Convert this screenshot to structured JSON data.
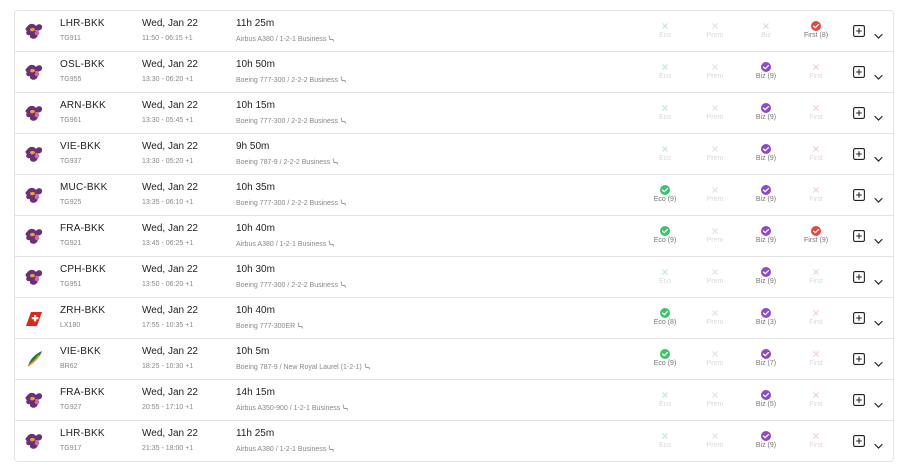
{
  "colors": {
    "eco": "#3cc46b",
    "biz": "#8f49c9",
    "first": "#e5473f",
    "off_x": "#c4ecd2",
    "off_x_prem": "#dde5f0",
    "off_x_biz": "#e2d8ec",
    "off_x_first": "#f5d3d0"
  },
  "flights": [
    {
      "airline_logo": "thai-airways-logo",
      "route": "LHR-BKK",
      "flight_no": "TG911",
      "date": "Wed, Jan 22",
      "times": "11:50 - 06:15 +1",
      "duration": "11h 25m",
      "aircraft": "Airbus A380 / 1-2-1 Business",
      "eco": {
        "label": "Eco",
        "available": false
      },
      "prem": {
        "label": "Prem",
        "available": false
      },
      "biz": {
        "label": "Biz",
        "available": false
      },
      "first": {
        "label": "First (8)",
        "available": true
      }
    },
    {
      "airline_logo": "thai-airways-logo",
      "route": "OSL-BKK",
      "flight_no": "TG955",
      "date": "Wed, Jan 22",
      "times": "13:30 - 06:20 +1",
      "duration": "10h 50m",
      "aircraft": "Boeing 777-300 / 2-2-2 Business",
      "eco": {
        "label": "Eco",
        "available": false
      },
      "prem": {
        "label": "Prem",
        "available": false
      },
      "biz": {
        "label": "Biz (9)",
        "available": true
      },
      "first": {
        "label": "First",
        "available": false
      }
    },
    {
      "airline_logo": "thai-airways-logo",
      "route": "ARN-BKK",
      "flight_no": "TG961",
      "date": "Wed, Jan 22",
      "times": "13:30 - 05:45 +1",
      "duration": "10h 15m",
      "aircraft": "Boeing 777-300 / 2-2-2 Business",
      "eco": {
        "label": "Eco",
        "available": false
      },
      "prem": {
        "label": "Prem",
        "available": false
      },
      "biz": {
        "label": "Biz (9)",
        "available": true
      },
      "first": {
        "label": "First",
        "available": false
      }
    },
    {
      "airline_logo": "thai-airways-logo",
      "route": "VIE-BKK",
      "flight_no": "TG937",
      "date": "Wed, Jan 22",
      "times": "13:30 - 05:20 +1",
      "duration": "9h 50m",
      "aircraft": "Boeing 787-9 / 2-2-2 Business",
      "eco": {
        "label": "Eco",
        "available": false
      },
      "prem": {
        "label": "Prem",
        "available": false
      },
      "biz": {
        "label": "Biz (9)",
        "available": true
      },
      "first": {
        "label": "First",
        "available": false
      }
    },
    {
      "airline_logo": "thai-airways-logo",
      "route": "MUC-BKK",
      "flight_no": "TG925",
      "date": "Wed, Jan 22",
      "times": "13:35 - 06:10 +1",
      "duration": "10h 35m",
      "aircraft": "Boeing 777-300 / 2-2-2 Business",
      "eco": {
        "label": "Eco (9)",
        "available": true
      },
      "prem": {
        "label": "Prem",
        "available": false
      },
      "biz": {
        "label": "Biz (9)",
        "available": true
      },
      "first": {
        "label": "First",
        "available": false
      }
    },
    {
      "airline_logo": "thai-airways-logo",
      "route": "FRA-BKK",
      "flight_no": "TG921",
      "date": "Wed, Jan 22",
      "times": "13:45 - 06:25 +1",
      "duration": "10h 40m",
      "aircraft": "Airbus A380 / 1-2-1 Business",
      "eco": {
        "label": "Eco (9)",
        "available": true
      },
      "prem": {
        "label": "Prem",
        "available": false
      },
      "biz": {
        "label": "Biz (9)",
        "available": true
      },
      "first": {
        "label": "First (9)",
        "available": true
      }
    },
    {
      "airline_logo": "thai-airways-logo",
      "route": "CPH-BKK",
      "flight_no": "TG951",
      "date": "Wed, Jan 22",
      "times": "13:50 - 06:20 +1",
      "duration": "10h 30m",
      "aircraft": "Boeing 777-300 / 2-2-2 Business",
      "eco": {
        "label": "Eco",
        "available": false
      },
      "prem": {
        "label": "Prem",
        "available": false
      },
      "biz": {
        "label": "Biz (9)",
        "available": true
      },
      "first": {
        "label": "First",
        "available": false
      }
    },
    {
      "airline_logo": "swiss-logo",
      "route": "ZRH-BKK",
      "flight_no": "LX180",
      "date": "Wed, Jan 22",
      "times": "17:55 - 10:35 +1",
      "duration": "10h 40m",
      "aircraft": "Boeing 777-300ER",
      "eco": {
        "label": "Eco (8)",
        "available": true
      },
      "prem": {
        "label": "Prem",
        "available": false
      },
      "biz": {
        "label": "Biz (3)",
        "available": true
      },
      "first": {
        "label": "First",
        "available": false
      }
    },
    {
      "airline_logo": "eva-air-logo",
      "route": "VIE-BKK",
      "flight_no": "BR62",
      "date": "Wed, Jan 22",
      "times": "18:25 - 10:30 +1",
      "duration": "10h 5m",
      "aircraft": "Boeing 787-9 / New Royal Laurel (1-2-1)",
      "eco": {
        "label": "Eco (9)",
        "available": true
      },
      "prem": {
        "label": "Prem",
        "available": false
      },
      "biz": {
        "label": "Biz (7)",
        "available": true
      },
      "first": {
        "label": "First",
        "available": false
      }
    },
    {
      "airline_logo": "thai-airways-logo",
      "route": "FRA-BKK",
      "flight_no": "TG927",
      "date": "Wed, Jan 22",
      "times": "20:55 - 17:10 +1",
      "duration": "14h 15m",
      "aircraft": "Airbus A350-900 / 1-2-1 Business",
      "eco": {
        "label": "Eco",
        "available": false
      },
      "prem": {
        "label": "Prem",
        "available": false
      },
      "biz": {
        "label": "Biz (5)",
        "available": true
      },
      "first": {
        "label": "First",
        "available": false
      }
    },
    {
      "airline_logo": "thai-airways-logo",
      "route": "LHR-BKK",
      "flight_no": "TG917",
      "date": "Wed, Jan 22",
      "times": "21:35 - 18:00 +1",
      "duration": "11h 25m",
      "aircraft": "Airbus A380 / 1-2-1 Business",
      "eco": {
        "label": "Eco",
        "available": false
      },
      "prem": {
        "label": "Prem",
        "available": false
      },
      "biz": {
        "label": "Biz (9)",
        "available": true
      },
      "first": {
        "label": "First",
        "available": false
      }
    }
  ]
}
